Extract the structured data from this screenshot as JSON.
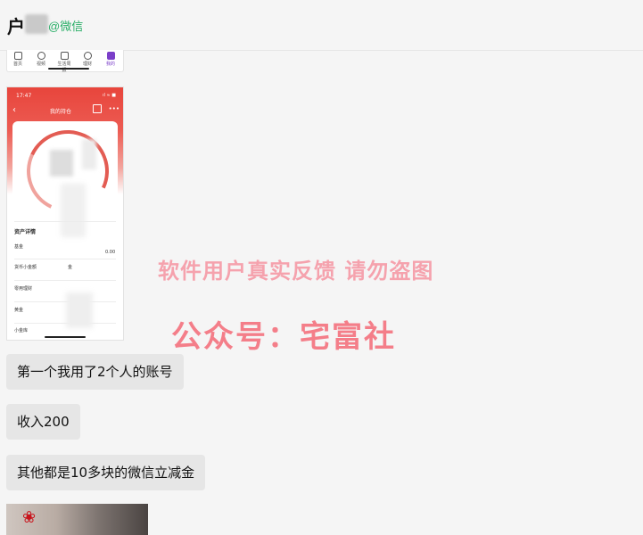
{
  "header": {
    "contact_name": "户",
    "contact_tag": "@微信"
  },
  "snippet_tabs": [
    "首页",
    "视频",
    "生活周报",
    "理财",
    "我的"
  ],
  "phone_screenshot": {
    "time": "17:47",
    "status": "ıl ≈ ■",
    "title": "我的持仓",
    "rows": [
      {
        "label": "资产详情",
        "value": ""
      },
      {
        "label": "基金",
        "value": "0.00"
      },
      {
        "label": "货币小金额",
        "value": "金"
      },
      {
        "label": "零用理财",
        "value": ""
      },
      {
        "label": "黄金",
        "value": ""
      },
      {
        "label": "小金库",
        "value": ""
      }
    ]
  },
  "messages": [
    {
      "text": "第一个我用了2个人的账号"
    },
    {
      "text": "收入200"
    },
    {
      "text": "其他都是10多块的微信立减金"
    }
  ],
  "watermark": {
    "line1": "软件用户真实反馈  请勿盗图",
    "line2": "公众号：宅富社"
  },
  "colors": {
    "wechat_green": "#2aae67",
    "watermark_pink": "#f4727e",
    "bubble_bg": "#e6e6e6",
    "app_red": "#e8453c"
  }
}
